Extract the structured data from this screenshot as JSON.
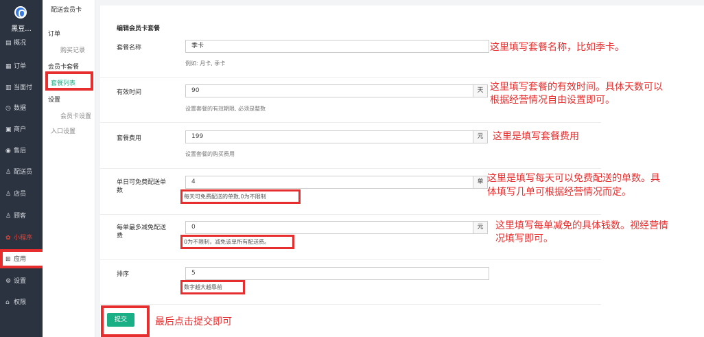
{
  "nav": {
    "brand": "黑豆...",
    "items": [
      {
        "icon": "overview-icon",
        "glyph": "▤",
        "label": "概况"
      },
      {
        "icon": "order-icon",
        "glyph": "▦",
        "label": "订单"
      },
      {
        "icon": "face-pay-icon",
        "glyph": "▥",
        "label": "当面付"
      },
      {
        "icon": "data-icon",
        "glyph": "◷",
        "label": "数据"
      },
      {
        "icon": "merchant-icon",
        "glyph": "▣",
        "label": "商户"
      },
      {
        "icon": "aftersale-icon",
        "glyph": "◉",
        "label": "售后"
      },
      {
        "icon": "courier-icon",
        "glyph": "♙",
        "label": "配送员"
      },
      {
        "icon": "clerk-icon",
        "glyph": "♙",
        "label": "店员"
      },
      {
        "icon": "customer-icon",
        "glyph": "♙",
        "label": "顾客"
      },
      {
        "icon": "mini-program-icon",
        "glyph": "✿",
        "label": "小程序"
      },
      {
        "icon": "apps-icon",
        "glyph": "⊞",
        "label": "应用"
      },
      {
        "icon": "settings-icon",
        "glyph": "⚙",
        "label": "设置"
      },
      {
        "icon": "permission-icon",
        "glyph": "⌂",
        "label": "权限"
      }
    ]
  },
  "sub": {
    "title": "配送会员卡",
    "order_head": "订单",
    "purchase_records": "购买记录",
    "card_plan_head": "会员卡套餐",
    "plan_list": "套餐列表",
    "settings_head": "设置",
    "card_settings": "会员卡设置",
    "entry_settings": "入口设置"
  },
  "form": {
    "title": "编辑会员卡套餐",
    "name": {
      "label": "套餐名称",
      "value": "季卡",
      "hint": "例如: 月卡, 季卡"
    },
    "duration": {
      "label": "有效时间",
      "value": "90",
      "unit": "天",
      "hint": "设置套餐的有效期限, 必须是整数"
    },
    "fee": {
      "label": "套餐费用",
      "value": "199",
      "unit": "元",
      "hint": "设置套餐的购买费用"
    },
    "free_orders": {
      "label_line1": "单日可免费配送单",
      "label_line2": "数",
      "value": "4",
      "unit": "单",
      "hint": "每天可免费配送的单数,0为不限制"
    },
    "max_discount": {
      "label_line1": "每单最多减免配送",
      "label_line2": "费",
      "value": "0",
      "unit": "元",
      "hint": "0为不限制，减免该单所有配送费。"
    },
    "sort": {
      "label": "排序",
      "value": "5",
      "hint": "数字越大越靠前"
    },
    "submit": "提交"
  },
  "annotations": {
    "name": "这里填写套餐名称，比如季卡。",
    "duration_1": "这里填写套餐的有效时间。具体天数可以",
    "duration_2": "根据经营情况自由设置即可。",
    "fee": "这里是填写套餐费用",
    "free_1": "这里是填写每天可以免费配送的单数。具",
    "free_2": "体填写几单可根据经营情况而定。",
    "discount_1": "这里填写每单减免的具体钱数。视经营情",
    "discount_2": "况填写即可。",
    "submit": "最后点击提交即可"
  },
  "colors": {
    "accent": "#1aaf84",
    "highlight": "#e62e2e",
    "nav_bg": "#2b3340"
  }
}
